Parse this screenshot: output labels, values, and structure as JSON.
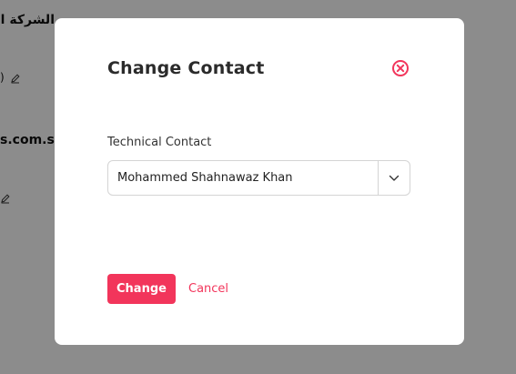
{
  "background": {
    "line1": "الشركة العربية",
    "line2": ")",
    "line3": "s.com.sa"
  },
  "modal": {
    "title": "Change Contact",
    "field_label": "Technical Contact",
    "selected_contact": "Mohammed Shahnawaz Khan",
    "change_label": "Change",
    "cancel_label": "Cancel"
  },
  "colors": {
    "accent": "#f2355b",
    "overlay": "rgba(0,0,0,0.45)"
  },
  "icons": {
    "close": "close-circle-icon",
    "dropdown": "chevron-down-icon",
    "edit": "pencil-icon"
  }
}
